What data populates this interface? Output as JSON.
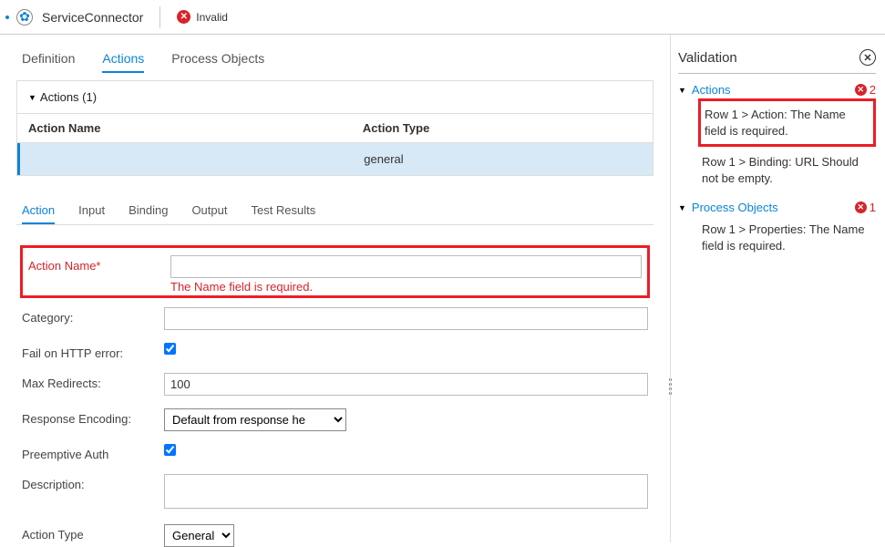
{
  "header": {
    "title": "ServiceConnector",
    "status_label": "Invalid"
  },
  "top_tabs": {
    "definition": "Definition",
    "actions": "Actions",
    "process_objects": "Process Objects"
  },
  "actions_panel": {
    "title": "Actions (1)",
    "cols": {
      "name": "Action Name",
      "type": "Action Type"
    },
    "row": {
      "name": "",
      "type": "general"
    }
  },
  "detail_tabs": {
    "action": "Action",
    "input": "Input",
    "binding": "Binding",
    "output": "Output",
    "test_results": "Test Results"
  },
  "form": {
    "action_name_label": "Action Name*",
    "action_name_value": "",
    "action_name_error": "The Name field is required.",
    "category_label": "Category:",
    "category_value": "",
    "fail_label": "Fail on HTTP error:",
    "max_redirects_label": "Max Redirects:",
    "max_redirects_value": "100",
    "resp_enc_label": "Response Encoding:",
    "resp_enc_selected": "Default from response he",
    "preemptive_label": "Preemptive Auth",
    "description_label": "Description:",
    "description_value": "",
    "action_type_label": "Action Type",
    "action_type_selected": "General"
  },
  "validation": {
    "title": "Validation",
    "groups": [
      {
        "label": "Actions",
        "count": "2",
        "items": [
          {
            "text": "Row 1 > Action: The Name field is required.",
            "highlighted": true
          },
          {
            "text": "Row 1 > Binding: URL Should not be empty.",
            "highlighted": false
          }
        ]
      },
      {
        "label": "Process Objects",
        "count": "1",
        "items": [
          {
            "text": "Row 1 > Properties: The Name field is required.",
            "highlighted": false
          }
        ]
      }
    ]
  }
}
